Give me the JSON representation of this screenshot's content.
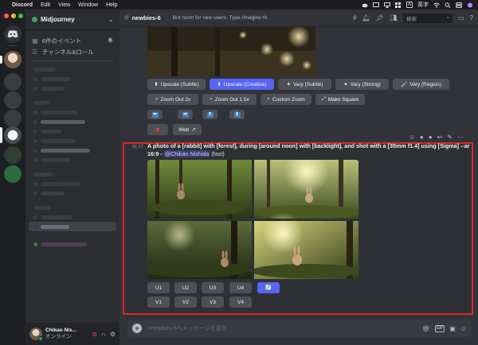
{
  "menubar": {
    "app": "Discord",
    "items": [
      "Edit",
      "View",
      "Window",
      "Help"
    ],
    "input_method": "A",
    "input_method_label": "英字"
  },
  "server": {
    "name": "Midjourney",
    "events": "6件のイベント",
    "events_count": "6",
    "channels_roles": "チャンネル&ロール"
  },
  "user": {
    "name": "Chikao Nis...",
    "status": "オンライン"
  },
  "channel": {
    "name": "newbies-6",
    "topic": "Bot room for new users. Type /imagine then describe what y...",
    "search_placeholder": "検索",
    "composer_placeholder": "#newbies-6へメッセージを送信"
  },
  "previous_message": {
    "buttons_row1": [
      {
        "label": "Upscale (Subtle)",
        "icon": "upscale-icon",
        "primary": false
      },
      {
        "label": "Upscale (Creative)",
        "icon": "upscale-icon",
        "primary": true
      },
      {
        "label": "Vary (Subtle)",
        "icon": "sparkle-icon",
        "primary": false
      },
      {
        "label": "Vary (Strong)",
        "icon": "sparkle-icon",
        "primary": false
      },
      {
        "label": "Vary (Region)",
        "icon": "brush-icon",
        "primary": false
      }
    ],
    "buttons_row2": [
      {
        "label": "Zoom Out 2x",
        "icon": "magnify-icon"
      },
      {
        "label": "Zoom Out 1.5x",
        "icon": "magnify-icon"
      },
      {
        "label": "Custom Zoom",
        "icon": "magnify-icon"
      },
      {
        "label": "Make Square",
        "icon": "expand-icon"
      }
    ],
    "arrows": [
      "⬅",
      "➡",
      "⬆",
      "⬇"
    ],
    "web_label": "Web"
  },
  "message": {
    "time": "01:17",
    "prompt": "A photo of a [rabbit] with [forest], during [around noon] with [backlight], and shot with a [35mm f1.4] using [Sigma] --ar 16:9",
    "separator": " - ",
    "mention": "@Chikao Nishida",
    "mode": " (fast)",
    "upscale_buttons": [
      "U1",
      "U2",
      "U3",
      "U4"
    ],
    "variation_buttons": [
      "V1",
      "V2",
      "V3",
      "V4"
    ],
    "reroll_icon": "🔄"
  },
  "colors": {
    "accent": "#5865f2",
    "highlight_border": "#d92b24",
    "online": "#23a55a"
  }
}
